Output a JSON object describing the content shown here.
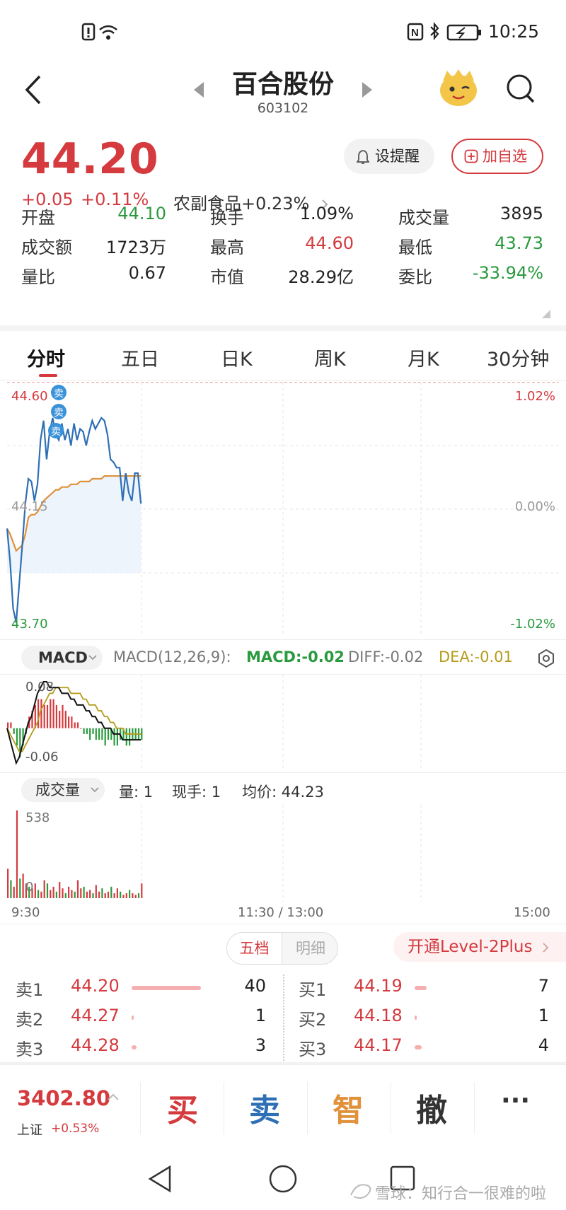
{
  "status_bar": {
    "time": "10:25"
  },
  "header": {
    "stock_name": "百合股份",
    "stock_code": "603102"
  },
  "quote": {
    "price": "44.20",
    "change": "+0.05",
    "change_pct": "+0.11%",
    "sector": "农副食品+0.23%",
    "alert_label": "设提醒",
    "watch_label": "加自选",
    "stats": [
      {
        "label": "开盘",
        "value": "44.10",
        "color": "#2a9a3e"
      },
      {
        "label": "换手",
        "value": "1.09%",
        "color": "#222222"
      },
      {
        "label": "成交量",
        "value": "3895",
        "color": "#222222"
      },
      {
        "label": "成交额",
        "value": "1723万",
        "color": "#222222"
      },
      {
        "label": "最高",
        "value": "44.60",
        "color": "#d43a3e"
      },
      {
        "label": "最低",
        "value": "43.73",
        "color": "#2a9a3e"
      },
      {
        "label": "量比",
        "value": "0.67",
        "color": "#222222"
      },
      {
        "label": "市值",
        "value": "28.29亿",
        "color": "#222222"
      },
      {
        "label": "委比",
        "value": "-33.94%",
        "color": "#2a9a3e"
      }
    ]
  },
  "tabs": [
    "分时",
    "五日",
    "日K",
    "周K",
    "月K",
    "30分钟"
  ],
  "intraday": {
    "y_high": "44.60",
    "y_mid": "44.15",
    "y_low": "43.70",
    "pct_high": "1.02%",
    "pct_mid": "0.00%",
    "pct_low": "-1.02%",
    "sell_marker": "卖",
    "time_start": "9:30",
    "time_mid": "11:30 / 13:00",
    "time_end": "15:00"
  },
  "macd": {
    "selector": "MACD",
    "params": "MACD(12,26,9):",
    "macd_label": "MACD:-0.02",
    "diff_label": "DIFF:-0.02",
    "dea_label": "DEA:-0.01",
    "y_high": "0.08",
    "y_low": "-0.06"
  },
  "volume": {
    "selector": "成交量",
    "qty_label": "量: 1",
    "hand_label": "现手: 1",
    "avg_label": "均价: 44.23",
    "peak_label": "538",
    "zero_label": "0"
  },
  "order_book": {
    "tab_five": "五档",
    "tab_detail": "明细",
    "level2_label": "开通Level-2Plus",
    "sells": [
      {
        "label": "卖1",
        "price": "44.20",
        "vol": "40"
      },
      {
        "label": "卖2",
        "price": "44.27",
        "vol": "1"
      },
      {
        "label": "卖3",
        "price": "44.28",
        "vol": "3"
      }
    ],
    "buys": [
      {
        "label": "买1",
        "price": "44.19",
        "vol": "7"
      },
      {
        "label": "买2",
        "price": "44.18",
        "vol": "1"
      },
      {
        "label": "买3",
        "price": "44.17",
        "vol": "4"
      }
    ]
  },
  "bottom_nav": {
    "index_value": "3402.80",
    "index_name": "上证",
    "index_change": "+0.53%",
    "buy": "买",
    "sell": "卖",
    "smart": "智",
    "cancel": "撤",
    "more": "···"
  },
  "watermark": "雪球：知行合一很难的啦",
  "chart_data": [
    {
      "type": "line",
      "title": "",
      "x": [
        0,
        1,
        2,
        3,
        4,
        5,
        6,
        7,
        8,
        9,
        10,
        11,
        12,
        13,
        14,
        15,
        16,
        17,
        18,
        19,
        20,
        21,
        22,
        23,
        24,
        25,
        26,
        27,
        28,
        29,
        30,
        31,
        32,
        33,
        34,
        35,
        36,
        37,
        38,
        39,
        40,
        41,
        42,
        43,
        44
      ],
      "series": [
        {
          "values": [
            44.08,
            43.96,
            43.79,
            43.74,
            43.88,
            44.02,
            44.17,
            44.26,
            44.25,
            44.18,
            44.24,
            44.4,
            44.47,
            44.33,
            44.43,
            44.48,
            44.42,
            44.4,
            44.46,
            44.4,
            44.44,
            44.38,
            44.46,
            44.4,
            44.44,
            44.43,
            44.38,
            44.43,
            44.47,
            44.44,
            44.46,
            44.48,
            44.47,
            44.42,
            44.33,
            44.32,
            44.3,
            44.3,
            44.18,
            44.28,
            44.21,
            44.18,
            44.28,
            44.28,
            44.17
          ]
        },
        {
          "values": [
            44.08,
            44.06,
            44.03,
            44.0,
            44.01,
            44.02,
            44.06,
            44.12,
            44.13,
            44.13,
            44.14,
            44.16,
            44.18,
            44.19,
            44.2,
            44.21,
            44.22,
            44.22,
            44.23,
            44.23,
            44.23,
            44.24,
            44.24,
            44.24,
            44.25,
            44.25,
            44.25,
            44.25,
            44.26,
            44.26,
            44.26,
            44.26,
            44.27,
            44.27,
            44.27,
            44.27,
            44.27,
            44.27,
            44.27,
            44.27,
            44.27,
            44.27,
            44.27,
            44.27,
            44.27
          ]
        }
      ],
      "ylim": [
        43.7,
        44.6
      ],
      "grid": true
    },
    {
      "type": "bar",
      "title": "",
      "categories": [
        0,
        1,
        2,
        3,
        4,
        5,
        6,
        7,
        8,
        9,
        10,
        11,
        12,
        13,
        14,
        15,
        16,
        17,
        18,
        19,
        20,
        21,
        22,
        23,
        24,
        25,
        26,
        27,
        28,
        29,
        30,
        31,
        32,
        33,
        34,
        35,
        36,
        37,
        38,
        39,
        40,
        41,
        42,
        43,
        44
      ],
      "values": [
        0.01,
        0.01,
        -0.01,
        -0.03,
        -0.05,
        -0.03,
        -0.01,
        0.02,
        0.03,
        0.04,
        0.05,
        0.05,
        0.04,
        0.04,
        0.05,
        0.05,
        0.04,
        0.03,
        0.04,
        0.03,
        0.02,
        0.02,
        0.01,
        0.01,
        0.0,
        -0.01,
        -0.01,
        -0.02,
        -0.01,
        -0.02,
        -0.02,
        -0.02,
        -0.03,
        -0.02,
        -0.02,
        -0.03,
        -0.03,
        -0.02,
        -0.02,
        -0.03,
        -0.03,
        -0.02,
        -0.02,
        -0.02,
        -0.02
      ],
      "series": [
        {
          "name": "DIFF",
          "values": [
            0.0,
            -0.02,
            -0.04,
            -0.06,
            -0.05,
            -0.03,
            -0.01,
            0.01,
            0.02,
            0.04,
            0.06,
            0.07,
            0.08,
            0.08,
            0.07,
            0.07,
            0.07,
            0.07,
            0.06,
            0.06,
            0.06,
            0.05,
            0.05,
            0.04,
            0.04,
            0.04,
            0.03,
            0.03,
            0.02,
            0.02,
            0.01,
            0.01,
            0.0,
            0.0,
            0.0,
            -0.01,
            -0.01,
            -0.01,
            -0.02,
            -0.02,
            -0.02,
            -0.02,
            -0.02,
            -0.02,
            -0.02
          ]
        },
        {
          "name": "DEA",
          "values": [
            0.0,
            -0.01,
            -0.02,
            -0.03,
            -0.04,
            -0.04,
            -0.03,
            -0.02,
            -0.01,
            0.0,
            0.01,
            0.03,
            0.04,
            0.05,
            0.06,
            0.06,
            0.07,
            0.07,
            0.07,
            0.07,
            0.07,
            0.06,
            0.06,
            0.06,
            0.06,
            0.05,
            0.05,
            0.04,
            0.04,
            0.04,
            0.03,
            0.03,
            0.02,
            0.02,
            0.01,
            0.01,
            0.0,
            0.0,
            0.0,
            -0.01,
            -0.01,
            -0.01,
            -0.01,
            -0.01,
            -0.01
          ]
        }
      ],
      "ylim": [
        -0.06,
        0.08
      ]
    },
    {
      "type": "bar",
      "title": "",
      "categories": [
        0,
        1,
        2,
        3,
        4,
        5,
        6,
        7,
        8,
        9,
        10,
        11,
        12,
        13,
        14,
        15,
        16,
        17,
        18,
        19,
        20,
        21,
        22,
        23,
        24,
        25,
        26,
        27,
        28,
        29,
        30,
        31,
        32,
        33,
        34,
        35,
        36,
        37,
        38,
        39,
        40,
        41,
        42,
        43,
        44
      ],
      "values": [
        180,
        110,
        70,
        538,
        120,
        150,
        90,
        70,
        60,
        90,
        50,
        40,
        110,
        90,
        50,
        70,
        40,
        100,
        60,
        30,
        70,
        50,
        40,
        110,
        60,
        70,
        40,
        50,
        30,
        80,
        40,
        60,
        30,
        40,
        70,
        30,
        60,
        40,
        20,
        30,
        50,
        30,
        20,
        30,
        90
      ],
      "ylim": [
        0,
        538
      ]
    }
  ]
}
